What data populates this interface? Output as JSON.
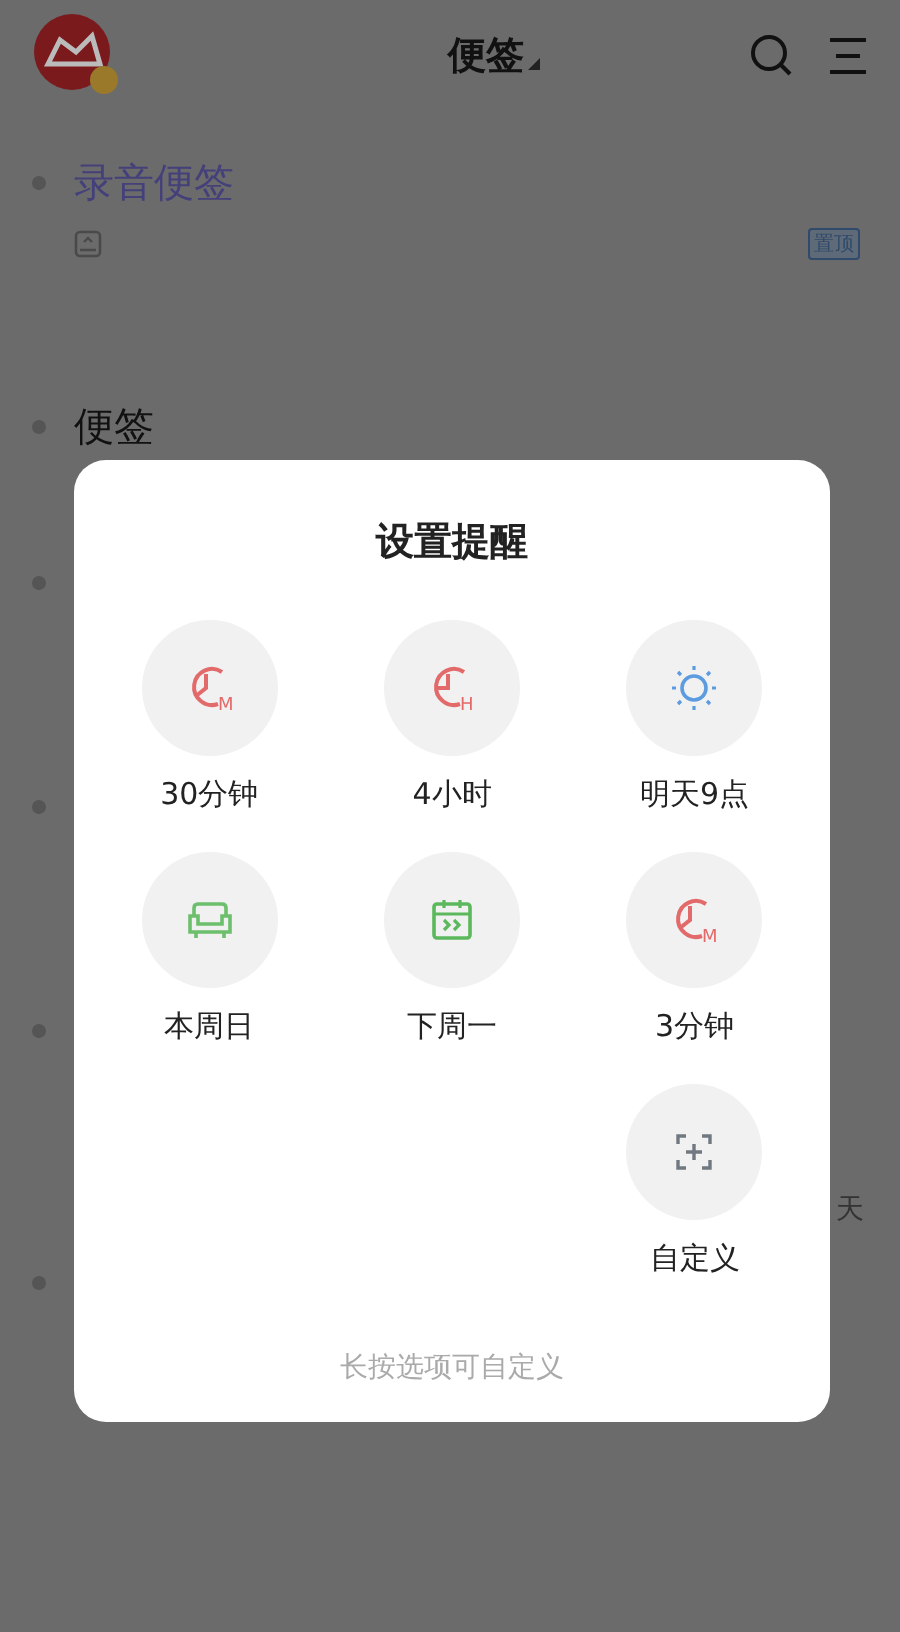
{
  "header": {
    "title": "便签"
  },
  "notes": [
    {
      "title": "录音便签",
      "kind": "voice",
      "badge": "置顶"
    },
    {
      "title": "便签",
      "kind": "plain"
    },
    {
      "kind": "plain"
    },
    {
      "kind": "plain"
    },
    {
      "kind": "plain",
      "trailing": "天"
    },
    {
      "kind": "plain"
    }
  ],
  "dialog": {
    "title": "设置提醒",
    "options": [
      {
        "label": "30分钟",
        "kind": "clock",
        "letter": "M"
      },
      {
        "label": "4小时",
        "kind": "clock-hour",
        "letter": "H"
      },
      {
        "label": "明天9点",
        "kind": "sun"
      },
      {
        "label": "本周日",
        "kind": "sofa"
      },
      {
        "label": "下周一",
        "kind": "calendar"
      },
      {
        "label": "3分钟",
        "kind": "clock",
        "letter": "M"
      },
      {
        "label": "自定义",
        "kind": "custom"
      }
    ],
    "hint": "长按选项可自定义"
  }
}
